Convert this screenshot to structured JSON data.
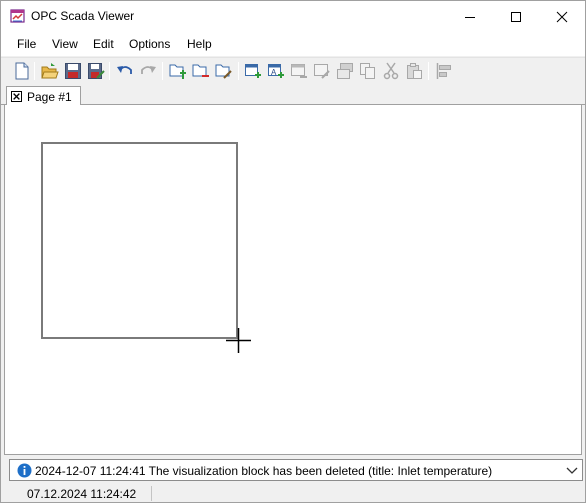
{
  "window": {
    "title": "OPC Scada Viewer"
  },
  "menu": {
    "items": [
      "File",
      "View",
      "Edit",
      "Options",
      "Help"
    ]
  },
  "toolbar": {
    "buttons": [
      {
        "name": "new-page-icon"
      },
      {
        "name": "open-folder-icon"
      },
      {
        "name": "save-icon"
      },
      {
        "name": "save-as-icon"
      },
      {
        "name": "undo-icon"
      },
      {
        "name": "redo-icon"
      },
      {
        "name": "add-page-icon"
      },
      {
        "name": "remove-page-icon"
      },
      {
        "name": "edit-page-icon"
      },
      {
        "name": "add-block-icon"
      },
      {
        "name": "add-text-block-icon"
      },
      {
        "name": "remove-block-icon"
      },
      {
        "name": "edit-block-icon"
      },
      {
        "name": "bring-front-icon"
      },
      {
        "name": "copy-icon"
      },
      {
        "name": "cut-icon"
      },
      {
        "name": "paste-icon"
      },
      {
        "name": "align-icon"
      }
    ]
  },
  "tabs": [
    {
      "label": "Page #1"
    }
  ],
  "log": {
    "message": "2024-12-07 11:24:41 The visualization block has been deleted (title: Inlet temperature)"
  },
  "status": {
    "datetime": "07.12.2024 11:24:42"
  },
  "colors": {
    "accent": "#0078d4",
    "block_border": "#7a7a7a",
    "info_blue": "#1e6fc8"
  }
}
